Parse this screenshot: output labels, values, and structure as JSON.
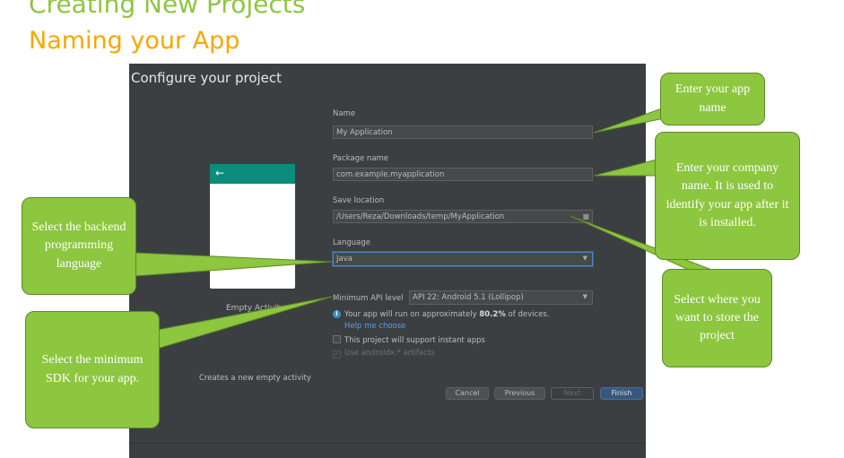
{
  "slide": {
    "title": "Creating New Projects",
    "subtitle": "Naming your App"
  },
  "dialog": {
    "title": "Configure your project",
    "template": {
      "name": "Empty Activity",
      "description": "Creates a new empty activity",
      "back_icon": "back-arrow-icon"
    },
    "fields": {
      "name_label": "Name",
      "name_value": "My Application",
      "package_label": "Package name",
      "package_value": "com.example.myapplication",
      "save_label": "Save location",
      "save_value": "/Users/Reza/Downloads/temp/MyApplication",
      "language_label": "Language",
      "language_value": "Java",
      "api_label": "Minimum API level",
      "api_value": "API 22: Android 5.1 (Lollipop)"
    },
    "info": {
      "text_prefix": "Your app will run on approximately",
      "percent": "80.2%",
      "text_suffix": "of devices.",
      "help_link": "Help me choose"
    },
    "checkboxes": {
      "instant_apps": "This project will support instant apps",
      "androidx": "Use androidx.* artifacts"
    },
    "buttons": {
      "cancel": "Cancel",
      "previous": "Previous",
      "next": "Next",
      "finish": "Finish"
    }
  },
  "callouts": {
    "app_name": "Enter your app name",
    "company": "Enter your company name. It is used to identify your app after it is installed.",
    "language": "Select the backend programming language",
    "storage": "Select where you want to store the project",
    "min_sdk": "Select the minimum SDK for your app."
  },
  "colors": {
    "title_green": "#8dc63f",
    "subtitle_orange": "#f6a800",
    "callout_green": "#8dc63f",
    "dialog_bg": "#3c3f41",
    "accent_teal": "#0b8c7c",
    "link_blue": "#589df6"
  }
}
